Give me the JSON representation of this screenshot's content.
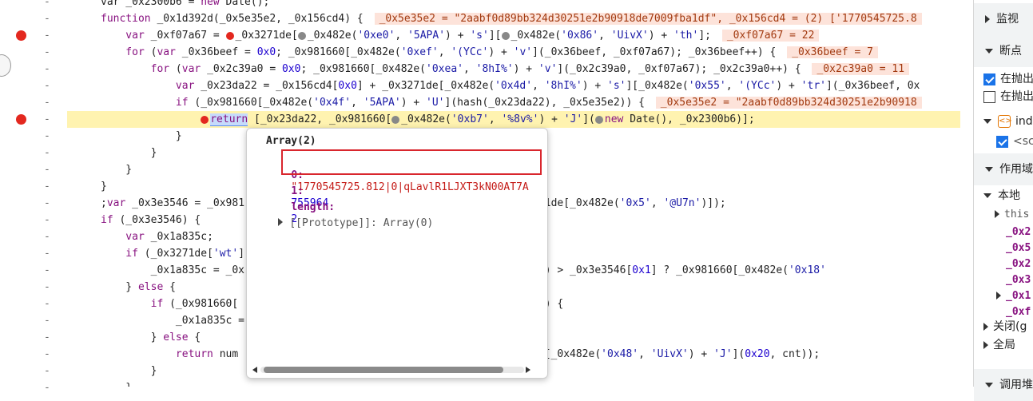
{
  "code_lines": [
    {
      "segments": [
        {
          "t": "var _0x2300b6 = ",
          "c": "fn"
        },
        {
          "t": "new ",
          "c": "kw"
        },
        {
          "t": "Date();",
          "c": "fn"
        }
      ]
    },
    {
      "segments": [
        {
          "t": "function ",
          "c": "kw"
        },
        {
          "t": "_0x1d392d(_0x5e35e2, _0x156cd4) { ",
          "c": "fn"
        }
      ],
      "inline": "_0x5e35e2 = \"2aabf0d89bb324d30251e2b90918de7009fba1df\", _0x156cd4 = (2) ['1770545725.8"
    },
    {
      "segments": [
        {
          "t": "    var ",
          "c": "kw"
        },
        {
          "t": "_0xf07a67 = ",
          "c": "fn"
        },
        {
          "t": "●",
          "c": "dotred"
        },
        {
          "t": "_0x3271de[",
          "c": "fn"
        },
        {
          "t": "●",
          "c": "dot"
        },
        {
          "t": "_0x482e(",
          "c": "fn"
        },
        {
          "t": "'0xe0'",
          "c": "str"
        },
        {
          "t": ", ",
          "c": "fn"
        },
        {
          "t": "'5APA'",
          "c": "str"
        },
        {
          "t": ") + ",
          "c": "fn"
        },
        {
          "t": "'s'",
          "c": "str"
        },
        {
          "t": "][",
          "c": "fn"
        },
        {
          "t": "●",
          "c": "dot"
        },
        {
          "t": "_0x482e(",
          "c": "fn"
        },
        {
          "t": "'0x86'",
          "c": "str"
        },
        {
          "t": ", ",
          "c": "fn"
        },
        {
          "t": "'UivX'",
          "c": "str"
        },
        {
          "t": ") + ",
          "c": "fn"
        },
        {
          "t": "'th'",
          "c": "str"
        },
        {
          "t": "]; ",
          "c": "fn"
        }
      ],
      "inline": "_0xf07a67 = 22"
    },
    {
      "segments": [
        {
          "t": "    for ",
          "c": "kw"
        },
        {
          "t": "(",
          "c": "fn"
        },
        {
          "t": "var ",
          "c": "kw"
        },
        {
          "t": "_0x36beef = ",
          "c": "fn"
        },
        {
          "t": "0x0",
          "c": "num"
        },
        {
          "t": "; _0x981660[_0x482e(",
          "c": "fn"
        },
        {
          "t": "'0xef'",
          "c": "str"
        },
        {
          "t": ", ",
          "c": "fn"
        },
        {
          "t": "'(YCc'",
          "c": "str"
        },
        {
          "t": ") + ",
          "c": "fn"
        },
        {
          "t": "'v'",
          "c": "str"
        },
        {
          "t": "](_0x36beef, _0xf07a67); _0x36beef++) { ",
          "c": "fn"
        }
      ],
      "inline": "_0x36beef = 7"
    },
    {
      "segments": [
        {
          "t": "        for ",
          "c": "kw"
        },
        {
          "t": "(",
          "c": "fn"
        },
        {
          "t": "var ",
          "c": "kw"
        },
        {
          "t": "_0x2c39a0 = ",
          "c": "fn"
        },
        {
          "t": "0x0",
          "c": "num"
        },
        {
          "t": "; _0x981660[_0x482e(",
          "c": "fn"
        },
        {
          "t": "'0xea'",
          "c": "str"
        },
        {
          "t": ", ",
          "c": "fn"
        },
        {
          "t": "'8hI%'",
          "c": "str"
        },
        {
          "t": ") + ",
          "c": "fn"
        },
        {
          "t": "'v'",
          "c": "str"
        },
        {
          "t": "](_0x2c39a0, _0xf07a67); _0x2c39a0++) { ",
          "c": "fn"
        }
      ],
      "inline": "_0x2c39a0 = 11"
    },
    {
      "segments": [
        {
          "t": "            var ",
          "c": "kw"
        },
        {
          "t": "_0x23da22 = _0x156cd4[",
          "c": "fn"
        },
        {
          "t": "0x0",
          "c": "num"
        },
        {
          "t": "] + _0x3271de[_0x482e(",
          "c": "fn"
        },
        {
          "t": "'0x4d'",
          "c": "str"
        },
        {
          "t": ", ",
          "c": "fn"
        },
        {
          "t": "'8hI%'",
          "c": "str"
        },
        {
          "t": ") + ",
          "c": "fn"
        },
        {
          "t": "'s'",
          "c": "str"
        },
        {
          "t": "][_0x482e(",
          "c": "fn"
        },
        {
          "t": "'0x55'",
          "c": "str"
        },
        {
          "t": ", ",
          "c": "fn"
        },
        {
          "t": "'(YCc'",
          "c": "str"
        },
        {
          "t": ") + ",
          "c": "fn"
        },
        {
          "t": "'tr'",
          "c": "str"
        },
        {
          "t": "](_0x36beef, 0x",
          "c": "fn"
        }
      ]
    },
    {
      "segments": [
        {
          "t": "            if ",
          "c": "kw"
        },
        {
          "t": "(_0x981660[_0x482e(",
          "c": "fn"
        },
        {
          "t": "'0x4f'",
          "c": "str"
        },
        {
          "t": ", ",
          "c": "fn"
        },
        {
          "t": "'5APA'",
          "c": "str"
        },
        {
          "t": ") + ",
          "c": "fn"
        },
        {
          "t": "'U'",
          "c": "str"
        },
        {
          "t": "](hash(_0x23da22), _0x5e35e2)) { ",
          "c": "fn"
        }
      ],
      "inline": "_0x5e35e2 = \"2aabf0d89bb324d30251e2b90918"
    },
    {
      "segments": [
        {
          "t": "                ",
          "c": "fn"
        },
        {
          "t": "●",
          "c": "dotred"
        },
        {
          "t": "return",
          "c": "kwsel"
        },
        {
          "t": " [_0x23da22, _0x981660[",
          "c": "fn"
        },
        {
          "t": "●",
          "c": "dot"
        },
        {
          "t": "_0x482e(",
          "c": "fn"
        },
        {
          "t": "'0xb7'",
          "c": "str"
        },
        {
          "t": ", ",
          "c": "fn"
        },
        {
          "t": "'%8v%'",
          "c": "str"
        },
        {
          "t": ") + ",
          "c": "fn"
        },
        {
          "t": "'J'",
          "c": "str"
        },
        {
          "t": "](",
          "c": "fn"
        },
        {
          "t": "●",
          "c": "dot"
        },
        {
          "t": "new ",
          "c": "kw"
        },
        {
          "t": "Date(), _0x2300b6)];",
          "c": "fn"
        }
      ],
      "hl": true
    },
    {
      "segments": [
        {
          "t": "            }",
          "c": "fn"
        }
      ]
    },
    {
      "segments": [
        {
          "t": "        }",
          "c": "fn"
        }
      ]
    },
    {
      "segments": [
        {
          "t": "    }",
          "c": "fn"
        }
      ]
    },
    {
      "segments": [
        {
          "t": "}",
          "c": "fn"
        }
      ]
    },
    {
      "segments": [
        {
          "t": ";",
          "c": "fn"
        },
        {
          "t": "var ",
          "c": "kw"
        },
        {
          "t": "_0x3e3546 = _0x981",
          "c": "fn"
        },
        {
          "t": "                         ",
          "c": "fn"
        },
        {
          "t": "_0x3271de[",
          "c": "fn"
        },
        {
          "t": "'ct'",
          "c": "str"
        },
        {
          "t": "], _0x3271de[_0x482e(",
          "c": "fn"
        },
        {
          "t": "'0x5'",
          "c": "str"
        },
        {
          "t": ", ",
          "c": "fn"
        },
        {
          "t": "'@U7n'",
          "c": "str"
        },
        {
          "t": ")]);",
          "c": "fn"
        }
      ]
    },
    {
      "segments": [
        {
          "t": "if ",
          "c": "kw"
        },
        {
          "t": "(_0x3e3546) {",
          "c": "fn"
        }
      ]
    },
    {
      "segments": [
        {
          "t": "    var ",
          "c": "kw"
        },
        {
          "t": "_0x1a835c;",
          "c": "fn"
        }
      ]
    },
    {
      "segments": [
        {
          "t": "    if ",
          "c": "kw"
        },
        {
          "t": "(_0x3271de[",
          "c": "fn"
        },
        {
          "t": "'wt'",
          "c": "str"
        },
        {
          "t": "]",
          "c": "fn"
        }
      ]
    },
    {
      "segments": [
        {
          "t": "        _0x1a835c = _0x",
          "c": "fn"
        },
        {
          "t": "                             ",
          "c": "fn"
        },
        {
          "t": "nt, _0x3271de[",
          "c": "fn"
        },
        {
          "t": "'wt'",
          "c": "str"
        },
        {
          "t": "]) > _0x3e3546[",
          "c": "fn"
        },
        {
          "t": "0x1",
          "c": "num"
        },
        {
          "t": "] ? _0x981660[_0x482e(",
          "c": "fn"
        },
        {
          "t": "'0x18'",
          "c": "str"
        }
      ]
    },
    {
      "segments": [
        {
          "t": "    } ",
          "c": "fn"
        },
        {
          "t": "else ",
          "c": "kw"
        },
        {
          "t": "{",
          "c": "fn"
        }
      ]
    },
    {
      "segments": [
        {
          "t": "        if ",
          "c": "kw"
        },
        {
          "t": "(_0x981660[",
          "c": "fn"
        },
        {
          "t": "                              ",
          "c": "fn"
        },
        {
          "t": "x83'",
          "c": "str"
        },
        {
          "t": ", ",
          "c": "fn"
        },
        {
          "t": "'gWbM'",
          "c": "str"
        },
        {
          "t": ") + ",
          "c": "fn"
        },
        {
          "t": "'l'",
          "c": "str"
        },
        {
          "t": ") {",
          "c": "fn"
        }
      ]
    },
    {
      "segments": [
        {
          "t": "            _0x1a835c =",
          "c": "fn"
        }
      ]
    },
    {
      "segments": [
        {
          "t": "        } ",
          "c": "fn"
        },
        {
          "t": "else ",
          "c": "kw"
        },
        {
          "t": "{",
          "c": "fn"
        }
      ]
    },
    {
      "segments": [
        {
          "t": "            return ",
          "c": "kw"
        },
        {
          "t": "num",
          "c": "fn"
        },
        {
          "t": "                              ",
          "c": "fn"
        },
        {
          "t": "'g'",
          "c": "str"
        },
        {
          "t": "](num, _0x981660[_0x482e(",
          "c": "fn"
        },
        {
          "t": "'0x48'",
          "c": "str"
        },
        {
          "t": ", ",
          "c": "fn"
        },
        {
          "t": "'UivX'",
          "c": "str"
        },
        {
          "t": ") + ",
          "c": "fn"
        },
        {
          "t": "'J'",
          "c": "str"
        },
        {
          "t": "](",
          "c": "fn"
        },
        {
          "t": "0x20",
          "c": "num"
        },
        {
          "t": ", cnt));",
          "c": "fn"
        }
      ]
    },
    {
      "segments": [
        {
          "t": "        }",
          "c": "fn"
        }
      ]
    },
    {
      "segments": [
        {
          "t": "    }",
          "c": "fn"
        }
      ]
    }
  ],
  "popover": {
    "title": "Array(2)",
    "item0_key": "0:",
    "item0_value": "\"1770545725.812|0|qLavlR1LJXT3kN00AT7A",
    "item1_key": "1:",
    "item1_value": "755964",
    "length_key": "length:",
    "length_value": "2",
    "proto_label": "[[Prototype]]: Array(0)"
  },
  "right_panel": {
    "watch_label": "监视",
    "breakpoints_label": "断点",
    "pause_uncaught": "在抛出",
    "pause_caught": "在抛出",
    "source_file": "ind",
    "source_snippet": "<sc",
    "scope_label": "作用域",
    "local_label": "本地",
    "this_label": "this",
    "scope_vars": [
      "_0x2",
      "_0x5",
      "_0x2",
      "_0x3",
      "_0x1",
      "_0xf"
    ],
    "closure_label": "关闭(g",
    "global_label": "全局",
    "callstack_label": "调用堆"
  }
}
